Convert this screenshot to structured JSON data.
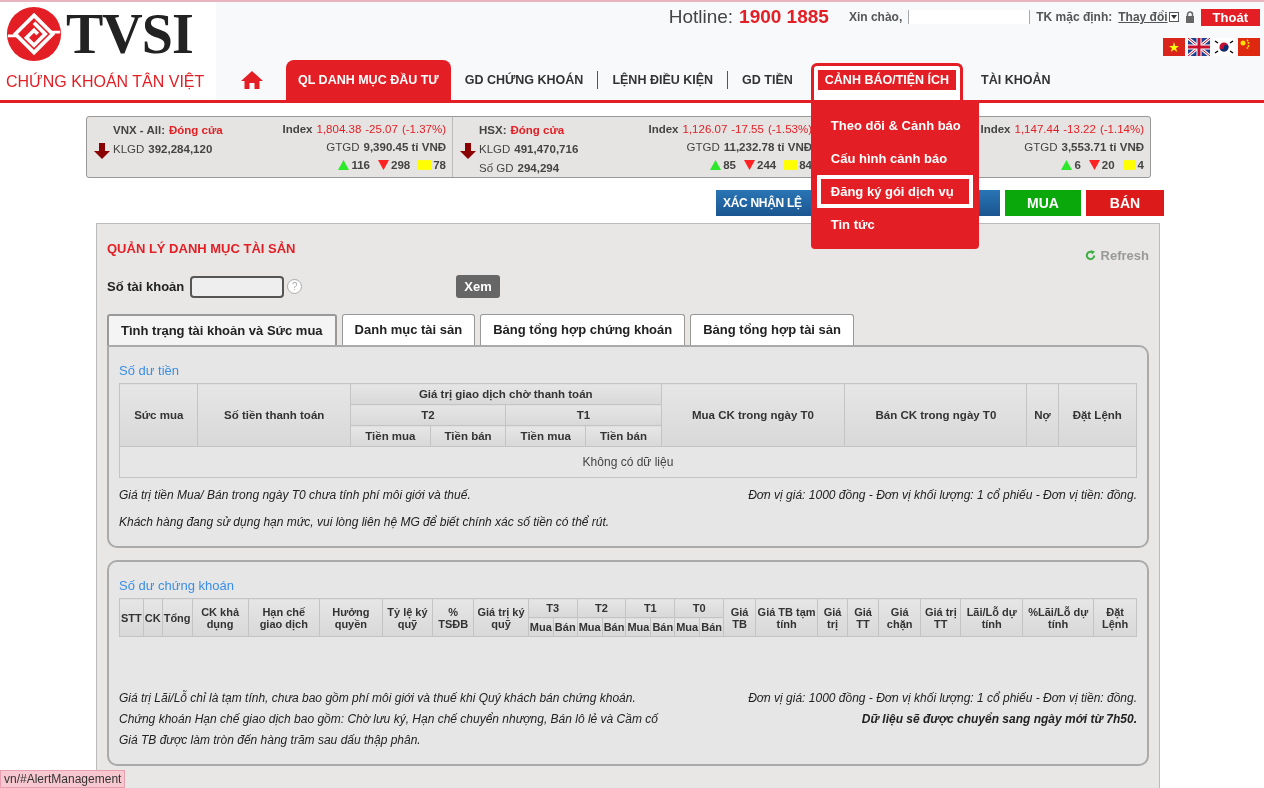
{
  "header": {
    "logo": "TVSI",
    "tagline": "CHỨNG KHOÁN TÂN VIỆT",
    "hotline_label": "Hotline:",
    "hotline": "1900 1885",
    "greeting": "Xin chào,",
    "default_account_label": "TK mặc định:",
    "change_link": "Thay đổi",
    "logout": "Thoát"
  },
  "nav": {
    "items": [
      {
        "label": "QL DANH MỤC ĐẦU TƯ",
        "selected": true,
        "expanded": false
      },
      {
        "label": "GD CHỨNG KHOÁN",
        "selected": false,
        "expanded": false
      },
      {
        "label": "LỆNH ĐIỀU KIỆN",
        "selected": false,
        "expanded": false
      },
      {
        "label": "GD TIỀN",
        "selected": false,
        "expanded": false
      },
      {
        "label": "CẢNH BÁO/TIỆN ÍCH",
        "selected": false,
        "expanded": true,
        "menu": [
          {
            "label": "Theo dõi & Cảnh báo",
            "selected": false
          },
          {
            "label": "Cấu hình cảnh báo",
            "selected": false
          },
          {
            "label": "Đăng ký gói dịch vụ",
            "selected": true
          },
          {
            "label": "Tin tức",
            "selected": false
          }
        ]
      },
      {
        "label": "TÀI KHOẢN",
        "selected": false,
        "expanded": false
      }
    ]
  },
  "markets": [
    {
      "name": "VNX - All:",
      "status": "Đóng cửa",
      "falling": true,
      "index_label": "Index",
      "index": "1,804.38",
      "change": "-25.07",
      "change_pct": "(-1.37%)",
      "klgd_label": "KLGD",
      "klgd": "392,284,120",
      "gtgd_label": "GTGD",
      "gtgd": "9,390.45 tỉ VNĐ",
      "up": "116",
      "down": "298",
      "flat": "78"
    },
    {
      "name": "HSX:",
      "status": "Đóng cửa",
      "falling": true,
      "index_label": "Index",
      "index": "1,126.07",
      "change": "-17.55",
      "change_pct": "(-1.53%)",
      "klgd_label": "KLGD",
      "klgd": "491,470,716",
      "sogd_label": "Số GD",
      "sogd": "294,294",
      "gtgd_label": "GTGD",
      "gtgd": "11,232.78 tỉ VNĐ",
      "up": "85",
      "down": "244",
      "flat": "84"
    },
    {
      "index_label": "Index",
      "index": "1,147.44",
      "change": "-13.22",
      "change_pct": "(-1.14%)",
      "gtgd_label": "GTGD",
      "gtgd": "3,553.71 tỉ VNĐ",
      "up": "6",
      "down": "20",
      "flat": "4"
    }
  ],
  "actions": [
    {
      "label": "XÁC NHẬN LỆ",
      "kind": "confirm"
    },
    {
      "label": "MUA",
      "kind": "buy"
    },
    {
      "label": "BÁN",
      "kind": "sell"
    }
  ],
  "panel": {
    "title": "QUẢN LÝ DANH MỤC TÀI SẢN",
    "refresh": "Refresh",
    "account_label": "Số tài khoản",
    "help": "?",
    "view_button": "Xem"
  },
  "tabs": [
    {
      "label": "Tình trạng tài khoản và Sức mua",
      "selected": true
    },
    {
      "label": "Danh mục tài sản",
      "selected": false
    },
    {
      "label": "Bảng tổng hợp chứng khoán",
      "selected": false
    },
    {
      "label": "Bảng tổng hợp tài sản",
      "selected": false
    }
  ],
  "sections": [
    {
      "title": "Số dư tiền",
      "header_rows": [
        [
          {
            "label": "Sức mua",
            "rowspan": 3
          },
          {
            "label": "Số tiền thanh toán",
            "rowspan": 3
          },
          {
            "label": "Giá trị giao dịch chờ thanh toán",
            "colspan": 4
          },
          {
            "label": "Mua CK trong ngày T0",
            "rowspan": 3
          },
          {
            "label": "Bán CK trong ngày T0",
            "rowspan": 3
          },
          {
            "label": "Nợ",
            "rowspan": 3
          },
          {
            "label": "Đặt Lệnh",
            "rowspan": 3
          }
        ],
        [
          {
            "label": "T2",
            "colspan": 2
          },
          {
            "label": "T1",
            "colspan": 2
          }
        ],
        [
          {
            "label": "Tiền mua"
          },
          {
            "label": "Tiền bán"
          },
          {
            "label": "Tiền mua"
          },
          {
            "label": "Tiền bán"
          }
        ]
      ],
      "empty_message": "Không có dữ liệu",
      "notes_left": [
        "Giá trị tiền Mua/ Bán trong ngày T0 chưa tính phí môi giới và thuế.",
        "Khách hàng đang sử dụng hạn mức, vui lòng liên hệ MG để biết chính xác số tiền có thể rút."
      ],
      "notes_right": [
        {
          "text": "Đơn vị giá: 1000 đồng - Đơn vị khối lượng: 1 cổ phiếu - Đơn vị tiền: đồng.",
          "bold": false
        }
      ]
    },
    {
      "title": "Số dư chứng khoán",
      "header_rows": [
        [
          {
            "label": "STT",
            "rowspan": 2
          },
          {
            "label": "CK",
            "rowspan": 2
          },
          {
            "label": "Tổng",
            "rowspan": 2
          },
          {
            "label": "CK khả dụng",
            "rowspan": 2
          },
          {
            "label": "Hạn chế giao dịch",
            "rowspan": 2
          },
          {
            "label": "Hưởng quyền",
            "rowspan": 2
          },
          {
            "label": "Tỷ lệ ký quỹ",
            "rowspan": 2
          },
          {
            "label": "% TSĐB",
            "rowspan": 2
          },
          {
            "label": "Giá trị ký quỹ",
            "rowspan": 2
          },
          {
            "label": "T3",
            "colspan": 2
          },
          {
            "label": "T2",
            "colspan": 2
          },
          {
            "label": "T1",
            "colspan": 2
          },
          {
            "label": "T0",
            "colspan": 2
          },
          {
            "label": "Giá TB",
            "rowspan": 2
          },
          {
            "label": "Giá TB tạm tính",
            "rowspan": 2
          },
          {
            "label": "Giá trị",
            "rowspan": 2
          },
          {
            "label": "Giá TT",
            "rowspan": 2
          },
          {
            "label": "Giá chặn",
            "rowspan": 2
          },
          {
            "label": "Giá trị TT",
            "rowspan": 2
          },
          {
            "label": "Lãi/Lỗ dự tính",
            "rowspan": 2
          },
          {
            "label": "%Lãi/Lỗ dự tính",
            "rowspan": 2
          },
          {
            "label": "Đặt Lệnh",
            "rowspan": 2
          }
        ],
        [
          {
            "label": "Mua"
          },
          {
            "label": "Bán"
          },
          {
            "label": "Mua"
          },
          {
            "label": "Bán"
          },
          {
            "label": "Mua"
          },
          {
            "label": "Bán"
          },
          {
            "label": "Mua"
          },
          {
            "label": "Bán"
          }
        ]
      ],
      "notes_left": [
        "Giá trị Lãi/Lỗ chỉ là tạm tính, chưa bao gồm phí môi giới và thuế khi Quý khách bán chứng khoán.",
        "Chứng khoán Hạn chế giao dịch bao gồm: Chờ lưu ký, Hạn chế chuyển nhượng, Bán lô lẻ và Cầm cố",
        "Giá TB được làm tròn đến hàng trăm sau dấu thập phân."
      ],
      "notes_right": [
        {
          "text": "Đơn vị giá: 1000 đồng - Đơn vị khối lượng: 1 cổ phiếu - Đơn vị tiền: đồng.",
          "bold": false
        },
        {
          "text": "Dữ liệu sẽ được chuyển sang ngày mới từ 7h50.",
          "bold": true
        }
      ]
    }
  ],
  "status_bar": "vn/#AlertManagement"
}
